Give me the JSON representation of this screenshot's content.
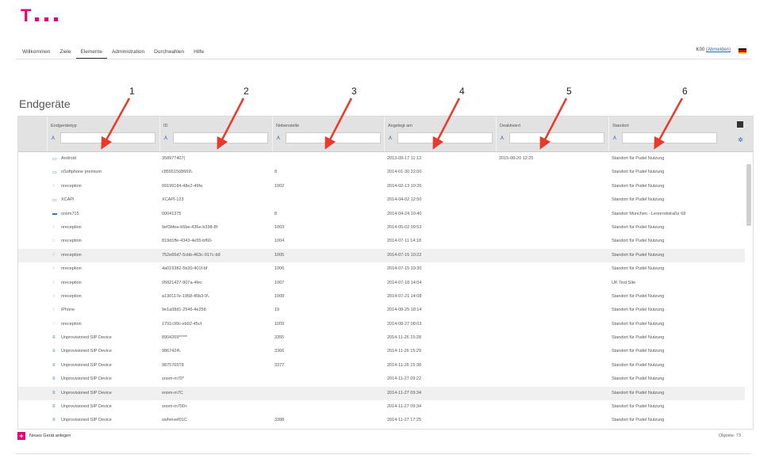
{
  "nav": {
    "items": [
      "Willkommen",
      "Ziele",
      "Elemente",
      "Administration",
      "Durchwahlen",
      "Hilfe"
    ],
    "active_index": 2
  },
  "user": {
    "name": "K00",
    "logout_label": "(Abmelden)"
  },
  "page_title": "Endgeräte",
  "annotation_numbers": [
    "1",
    "2",
    "3",
    "4",
    "5",
    "6"
  ],
  "columns": [
    "Endgerätetyp",
    "ID",
    "Nebenstelle",
    "Angelegt am",
    "Deaktiviert",
    "Standort"
  ],
  "rows": [
    {
      "type": "Android",
      "id": "358977407(",
      "ext": "",
      "created": "2013-09-17 11:13",
      "deact": "2015-08-20 12:25",
      "loc": "Standort für Pudel Nutzung",
      "icon": "device-icon"
    },
    {
      "type": "nSoftphone premium",
      "id": "c85551568669\\.",
      "ext": "8",
      "created": "2014-01-30 22:00",
      "deact": "",
      "loc": "Standort für Pudel Nutzung",
      "icon": "device-icon"
    },
    {
      "type": "nreception",
      "id": "09199184-48e2-49fa",
      "ext": "1002",
      "created": "2014-02-13 10:26",
      "deact": "",
      "loc": "Standort für Pudel Nutzung",
      "icon": "reception-icon"
    },
    {
      "type": "XCAPI",
      "id": "XCAPI-123",
      "ext": "",
      "created": "2014-04-02 12:50",
      "deact": "",
      "loc": "Standort für Pudel Nutzung",
      "icon": "device-icon"
    },
    {
      "type": "snom715",
      "id": "00041375",
      "ext": "8",
      "created": "2014-04-24 10:40",
      "deact": "",
      "loc": "Standort München - Leonrodstraße 68",
      "icon": "phone-icon"
    },
    {
      "type": "nreception",
      "id": "9ef3bfee-b5be-436e-b338-8f",
      "ext": "1003",
      "created": "2014-05-02 09:53",
      "deact": "",
      "loc": "Standort für Pudel Nutzung",
      "icon": "reception-icon"
    },
    {
      "type": "nreception",
      "id": "819d1ffe-4343-4e55-bf60-",
      "ext": "1004",
      "created": "2014-07-11 14:18",
      "deact": "",
      "loc": "Standort für Pudel Nutzung",
      "icon": "reception-icon"
    },
    {
      "type": "nreception",
      "id": "752e65d7-5cbb-463c-917c-b9",
      "ext": "1005",
      "created": "2014-07-15 10:22",
      "deact": "",
      "loc": "Standort für Pudel Nutzung",
      "icon": "reception-icon"
    },
    {
      "type": "nreception",
      "id": "4a015382-5b30-401f-bf",
      "ext": "1006",
      "created": "2014-07-15 10:30",
      "deact": "",
      "loc": "Standort für Pudel Nutzung",
      "icon": "reception-icon"
    },
    {
      "type": "nreception",
      "id": "05821427-907a-4fec",
      "ext": "1007",
      "created": "2014-07-18 14:04",
      "deact": "",
      "loc": "UK Test Site",
      "icon": "reception-icon"
    },
    {
      "type": "nreception",
      "id": "a130117e-1958-45b3-9\\.",
      "ext": "1008",
      "created": "2014-07-21 14:08",
      "deact": "",
      "loc": "Standort für Pudel Nutzung",
      "icon": "reception-icon"
    },
    {
      "type": "iPhone",
      "id": "9e1a08d1-2546-4e258",
      "ext": "19",
      "created": "2014-08-25 18:14",
      "deact": "",
      "loc": "Standort für Pudel Nutzung",
      "icon": "reception-icon"
    },
    {
      "type": "nreception",
      "id": "1791c99c-eb92-45cf",
      "ext": "1009",
      "created": "2014-08-27 08:03",
      "deact": "",
      "loc": "Standort für Pudel Nutzung",
      "icon": "reception-icon"
    },
    {
      "type": "Unprovisioned SIP Device",
      "id": "8904269*****",
      "ext": "3355",
      "created": "2014-11-26 15:28",
      "deact": "",
      "loc": "Standort für Pudel Nutzung",
      "icon": "sip-icon"
    },
    {
      "type": "Unprovisioned SIP Device",
      "id": "9867424\\.",
      "ext": "3366",
      "created": "2014-11-26 15:29",
      "deact": "",
      "loc": "Standort für Pudel Nutzung",
      "icon": "sip-icon"
    },
    {
      "type": "Unprovisioned SIP Device",
      "id": "9875765T8",
      "ext": "3377",
      "created": "2014-11-26 15:30",
      "deact": "",
      "loc": "Standort für Pudel Nutzung",
      "icon": "sip-icon"
    },
    {
      "type": "Unprovisioned SIP Device",
      "id": "snom-m70*",
      "ext": "",
      "created": "2014-11-27 09:22",
      "deact": "",
      "loc": "Standort für Pudel Nutzung",
      "icon": "sip-icon"
    },
    {
      "type": "Unprovisioned SIP Device",
      "id": "snom-m7C",
      "ext": "",
      "created": "2014-11-27 09:34",
      "deact": "",
      "loc": "Standort für Pudel Nutzung",
      "icon": "sip-icon"
    },
    {
      "type": "Unprovisioned SIP Device",
      "id": "snom-m700<",
      "ext": "",
      "created": "2014-11-27 09:34",
      "deact": "",
      "loc": "Standort für Pudel Nutzung",
      "icon": "sip-icon"
    },
    {
      "type": "Unprovisioned SIP Device",
      "id": "swhmsef01C",
      "ext": "3388",
      "created": "2014-11-27 17:25",
      "deact": "",
      "loc": "Standort für Pudel Nutzung",
      "icon": "sip-icon"
    }
  ],
  "footer": {
    "add_label": "Neues Gerät anlegen",
    "count": "Objekte: 73"
  },
  "colors": {
    "brand": "#e20074",
    "link": "#2a6aa8",
    "arrow": "#e8392a"
  }
}
